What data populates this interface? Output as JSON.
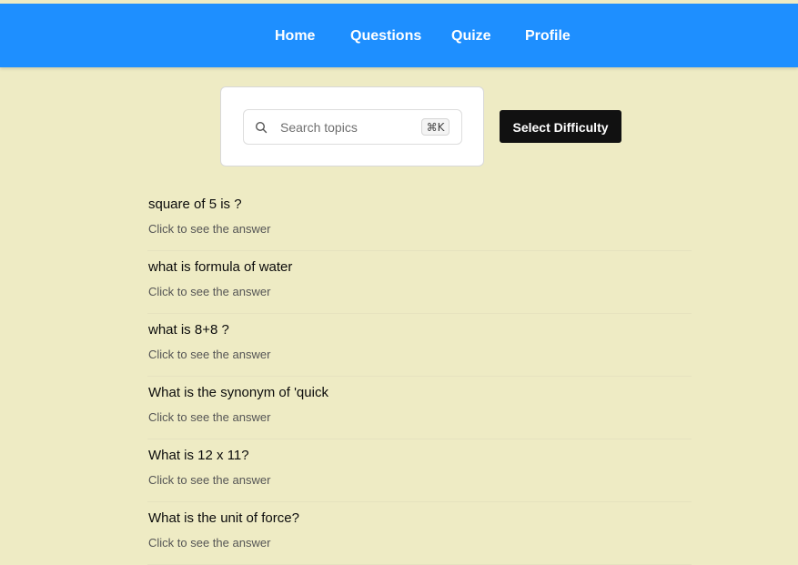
{
  "nav": {
    "items": [
      {
        "label": "Home"
      },
      {
        "label": "Questions"
      },
      {
        "label": "Quize"
      },
      {
        "label": "Profile"
      }
    ]
  },
  "search": {
    "placeholder": "Search topics",
    "shortcut": "⌘K",
    "icon": "search-icon"
  },
  "filters": {
    "difficulty_label": "Select Difficulty"
  },
  "questions": [
    {
      "title": "square of 5 is ?",
      "hint": "Click to see the answer"
    },
    {
      "title": "what is formula of water",
      "hint": "Click to see the answer"
    },
    {
      "title": "what is 8+8 ?",
      "hint": "Click to see the answer"
    },
    {
      "title": "What is the synonym of 'quick",
      "hint": "Click to see the answer"
    },
    {
      "title": "What is 12 x 11?",
      "hint": "Click to see the answer"
    },
    {
      "title": "What is the unit of force?",
      "hint": "Click to see the answer"
    }
  ],
  "colors": {
    "background": "#eeebc4",
    "header": "#1e8fff",
    "button": "#111111"
  }
}
